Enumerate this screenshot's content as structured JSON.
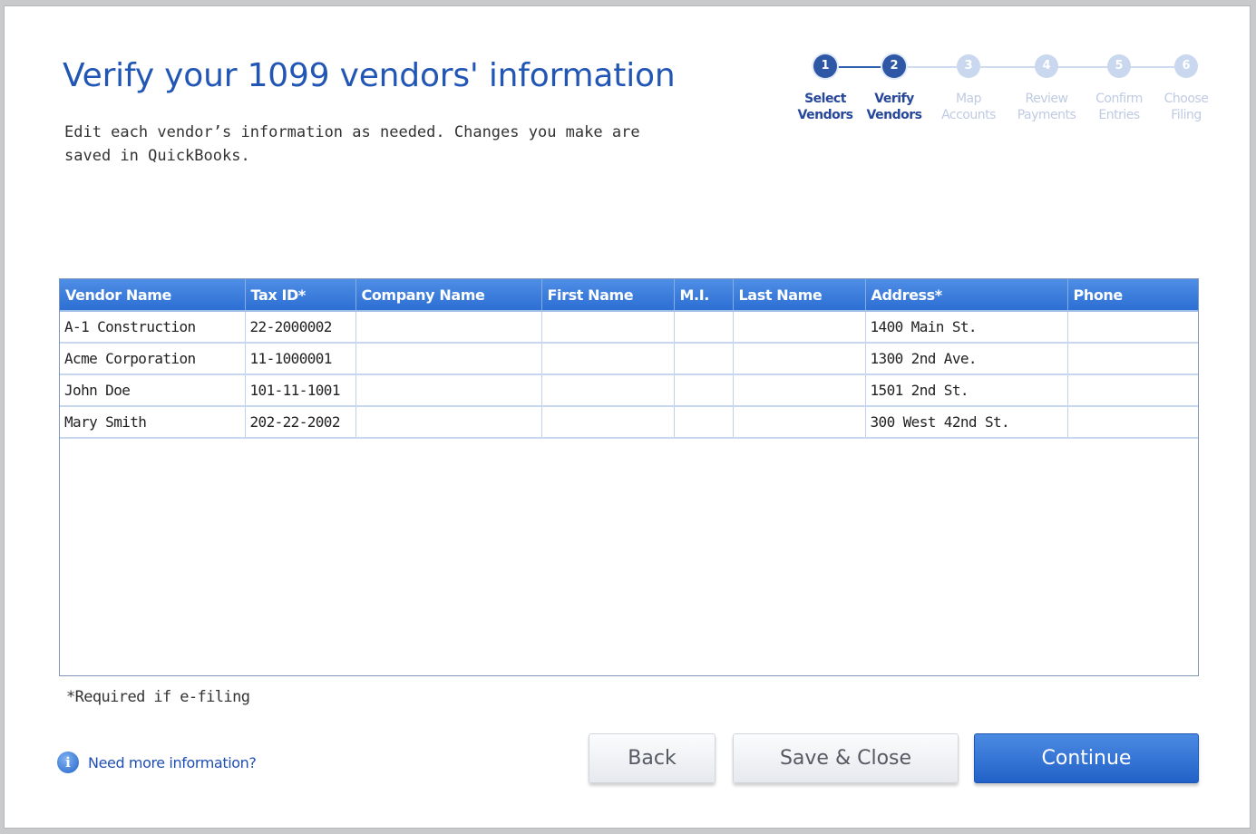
{
  "header": {
    "title": "Verify your 1099 vendors' information",
    "subtitle": "Edit each vendor’s information as needed. Changes you make are saved in QuickBooks."
  },
  "stepper": {
    "steps": [
      {
        "number": "1",
        "line1": "Select",
        "line2": "Vendors",
        "active": true
      },
      {
        "number": "2",
        "line1": "Verify",
        "line2": "Vendors",
        "active": true
      },
      {
        "number": "3",
        "line1": "Map",
        "line2": "Accounts",
        "active": false
      },
      {
        "number": "4",
        "line1": "Review",
        "line2": "Payments",
        "active": false
      },
      {
        "number": "5",
        "line1": "Confirm",
        "line2": "Entries",
        "active": false
      },
      {
        "number": "6",
        "line1": "Choose",
        "line2": "Filing",
        "active": false
      }
    ]
  },
  "table": {
    "columns": [
      "Vendor Name",
      "Tax ID*",
      "Company Name",
      "First Name",
      "M.I.",
      "Last Name",
      "Address*",
      "Phone"
    ],
    "rows": [
      [
        "A-1 Construction",
        "22-2000002",
        "",
        "",
        "",
        "",
        "1400 Main St.",
        ""
      ],
      [
        "Acme Corporation",
        "11-1000001",
        "",
        "",
        "",
        "",
        "1300 2nd Ave.",
        ""
      ],
      [
        "John Doe",
        "101-11-1001",
        "",
        "",
        "",
        "",
        "1501 2nd St.",
        ""
      ],
      [
        "Mary Smith",
        "202-22-2002",
        "",
        "",
        "",
        "",
        "300 West 42nd St.",
        ""
      ]
    ]
  },
  "footer": {
    "required_note": "*Required if e-filing",
    "help_link": "Need more information?",
    "info_glyph": "i",
    "back_label": "Back",
    "save_close_label": "Save & Close",
    "continue_label": "Continue"
  },
  "colors": {
    "title": "#2256b5",
    "header_bar": "#3b7ddb",
    "step_active": "#2e57a6",
    "step_inactive": "#c9d8ee",
    "primary_button": "#2f6fd3"
  },
  "icons": {
    "help": "info-icon"
  }
}
